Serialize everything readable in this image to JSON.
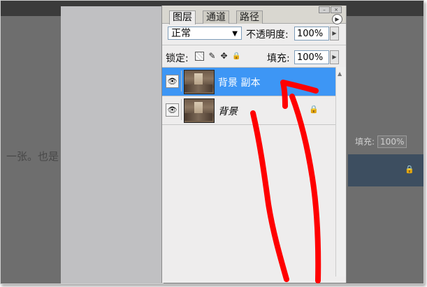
{
  "background": {
    "partial_text": "一张。也是",
    "fill_label": "填充:",
    "fill_value": "100%"
  },
  "layers_panel": {
    "tabs": [
      {
        "label": "图层",
        "active": true
      },
      {
        "label": "通道",
        "active": false
      },
      {
        "label": "路径",
        "active": false
      }
    ],
    "blend_mode": "正常",
    "opacity_label": "不透明度:",
    "opacity_value": "100%",
    "lock_label": "锁定:",
    "fill_label": "填充:",
    "fill_value": "100%",
    "layers": [
      {
        "name": "背景 副本",
        "selected": true,
        "locked": false
      },
      {
        "name": "背景",
        "selected": false,
        "locked": true
      }
    ]
  },
  "colors": {
    "selection": "#3d96f5",
    "annotation": "#ff0000"
  },
  "icons": [
    "eye-icon",
    "lock-icon",
    "brush-icon",
    "move-icon",
    "panel-menu-icon"
  ]
}
